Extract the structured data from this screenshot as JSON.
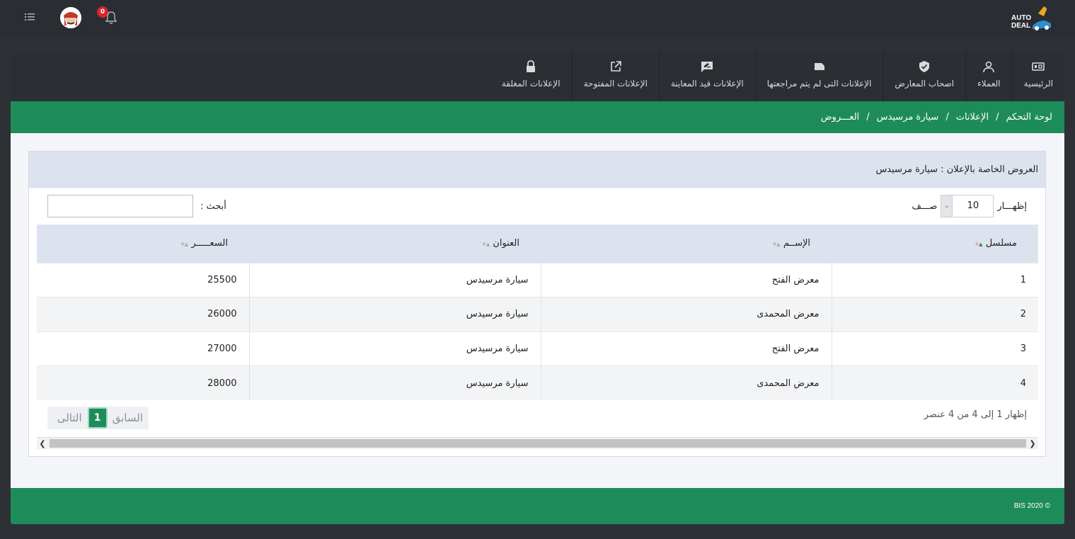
{
  "topbar": {
    "logo_line1": "AUTO",
    "logo_line2": "DEAL",
    "notification_count": "0"
  },
  "nav": [
    {
      "label": "الرئيسية",
      "icon": "dashboard-icon"
    },
    {
      "label": "العملاء",
      "icon": "user-icon"
    },
    {
      "label": "اصحاب المعارض",
      "icon": "shield-icon"
    },
    {
      "label": "الإعلانات التى لم يتم مراجعتها",
      "icon": "tag-icon"
    },
    {
      "label": "الإعلانات قيد المعاينة",
      "icon": "review-icon"
    },
    {
      "label": "الإعلانات المفتوحة",
      "icon": "external-link-icon"
    },
    {
      "label": "الإعلانات المغلقة",
      "icon": "lock-icon"
    }
  ],
  "breadcrumb": [
    "لوحة التحكم",
    "الإعلانات",
    "سيارة مرسيدس",
    "العـــروض"
  ],
  "card": {
    "title": "العروض الخاصة بالإعلان : سيارة مرسيدس"
  },
  "length": {
    "show_label": "إظهـــار",
    "value": "10",
    "rows_label": "صـــف"
  },
  "search": {
    "label": "أبحث :",
    "value": ""
  },
  "table": {
    "headers": [
      "مسلسل",
      "الإســم",
      "العنوان",
      "السعـــــر"
    ],
    "rows": [
      [
        "1",
        "معرض الفتح",
        "سيارة مرسيدس",
        "25500"
      ],
      [
        "2",
        "معرض المحمدى",
        "سيارة مرسيدس",
        "26000"
      ],
      [
        "3",
        "معرض الفتح",
        "سيارة مرسيدس",
        "27000"
      ],
      [
        "4",
        "معرض المحمدى",
        "سيارة مرسيدس",
        "28000"
      ]
    ]
  },
  "info": "إظهار 1 إلى 4 من 4 عنصر",
  "pager": {
    "prev": "السابق",
    "current": "1",
    "next": "التالى"
  },
  "footer": {
    "copyright": "BIS 2020 ©"
  },
  "colors": {
    "accent": "#1e8c5a",
    "header_dark": "#2a2e33",
    "badge": "#d9242b"
  }
}
